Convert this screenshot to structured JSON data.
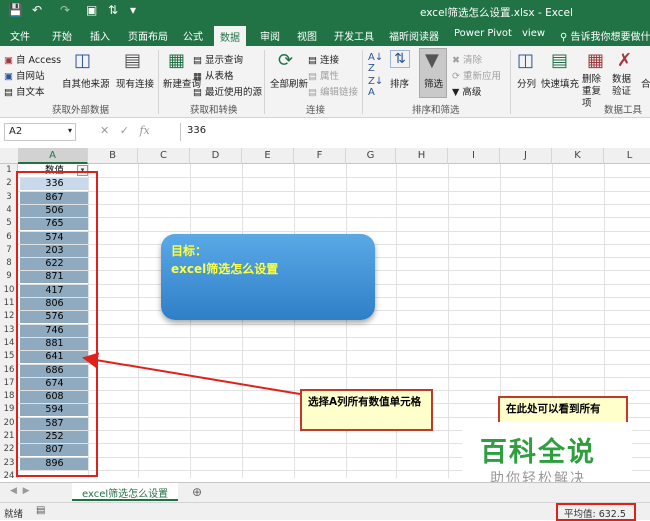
{
  "window": {
    "title": "excel筛选怎么设置.xlsx - Excel"
  },
  "ribbon_tabs": [
    "文件",
    "开始",
    "插入",
    "页面布局",
    "公式",
    "数据",
    "审阅",
    "视图",
    "开发工具",
    "福昕阅读器",
    "Power Pivot",
    "view"
  ],
  "active_tab": "数据",
  "tell_me": "告诉我你想要做什么",
  "ribbon": {
    "get_external": {
      "access": "自 Access",
      "web": "自网站",
      "text": "自文本",
      "other": "自其他来源",
      "existing": "现有连接",
      "label": "获取外部数据"
    },
    "transform": {
      "new_query": "新建查询",
      "show_query": "显示查询",
      "from_table": "从表格",
      "recent": "最近使用的源",
      "label": "获取和转换"
    },
    "connections": {
      "refresh_all": "全部刷新",
      "connections": "连接",
      "properties": "属性",
      "edit_links": "编辑链接",
      "label": "连接"
    },
    "sort_filter": {
      "sort": "排序",
      "filter": "筛选",
      "clear": "清除",
      "reapply": "重新应用",
      "advanced": "高级",
      "label": "排序和筛选"
    },
    "data_tools": {
      "split": "分列",
      "flash_fill": "快速填充",
      "remove_dup": "删除重复项",
      "validation": "数据验证",
      "merge": "合",
      "label": "数据工具"
    }
  },
  "formula_bar": {
    "name_box": "A2",
    "value": "336"
  },
  "grid": {
    "columns": [
      "A",
      "B",
      "C",
      "D",
      "E",
      "F",
      "G",
      "H",
      "I",
      "J",
      "K",
      "L"
    ],
    "rows": [
      "1",
      "2",
      "3",
      "4",
      "5",
      "6",
      "7",
      "8",
      "9",
      "10",
      "11",
      "12",
      "13",
      "14",
      "15",
      "16",
      "17",
      "18",
      "19",
      "20",
      "21",
      "22",
      "23",
      "24"
    ],
    "header_cell": "数值",
    "values": [
      "336",
      "867",
      "506",
      "765",
      "574",
      "203",
      "622",
      "871",
      "417",
      "806",
      "576",
      "746",
      "881",
      "641",
      "686",
      "674",
      "608",
      "594",
      "587",
      "252",
      "807",
      "896"
    ]
  },
  "annotations": {
    "goal_line1": "目标：",
    "goal_line2": "excel筛选怎么设置",
    "callout_select": "选择A列所有数值单元格",
    "callout_status": "在此处可以看到所有"
  },
  "watermark": {
    "title": "百科全说",
    "subtitle": "助你轻松解决"
  },
  "sheet_tab": "excel筛选怎么设置",
  "status": {
    "ready": "就绪",
    "average": "平均值: 632.5"
  },
  "colors": {
    "excel_green": "#217346",
    "selection_fill": "#8faabf",
    "annotation_red": "#e0201a"
  }
}
